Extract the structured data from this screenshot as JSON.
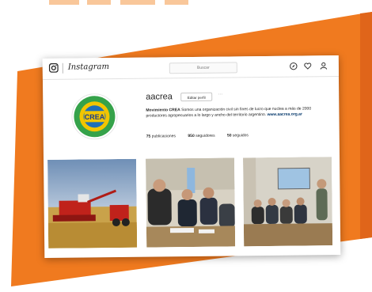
{
  "colors": {
    "orange": "#f07a1f",
    "orange_dark": "#e0651a"
  },
  "nav": {
    "logo_icon": "instagram-camera-icon",
    "wordmark": "Instagram",
    "search_placeholder": "Buscar",
    "icons": [
      "compass-icon",
      "heart-icon",
      "person-icon"
    ]
  },
  "profile": {
    "avatar_text": "CREA",
    "username": "aacrea",
    "edit_button": "Editar perfil",
    "more": "···",
    "bio_name": "Movimiento CREA",
    "bio_text": " Somos una organización civil sin fines de lucro que nuclea a más de 2000 productores agropecuarios a lo largo y ancho del territorio argentino. ",
    "bio_link": "www.aacrea.org.ar",
    "stats": {
      "posts_count": "75",
      "posts_label": " publicaciones",
      "followers_count": "950",
      "followers_label": " seguidores",
      "following_count": "50",
      "following_label": " seguidos"
    }
  },
  "posts": [
    {
      "subject": "harvester-photo"
    },
    {
      "subject": "meeting-photo"
    },
    {
      "subject": "conference-photo"
    }
  ]
}
